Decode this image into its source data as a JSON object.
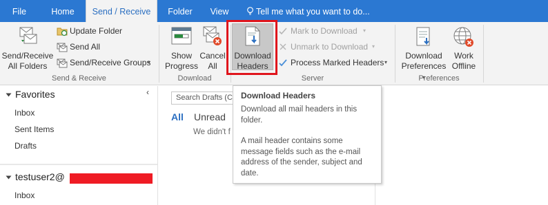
{
  "tabs": [
    {
      "label": "File",
      "active": false
    },
    {
      "label": "Home",
      "active": false
    },
    {
      "label": "Send / Receive",
      "active": true
    },
    {
      "label": "Folder",
      "active": false
    },
    {
      "label": "View",
      "active": false
    }
  ],
  "tell_me": "Tell me what you want to do...",
  "ribbon": {
    "send_receive_group": {
      "label": "Send & Receive",
      "send_receive_all": [
        "Send/Receive",
        "All Folders"
      ],
      "update_folder": "Update Folder",
      "send_all": "Send All",
      "send_receive_groups": "Send/Receive Groups"
    },
    "download_group": {
      "label": "Download",
      "show_progress": [
        "Show",
        "Progress"
      ],
      "cancel_all": [
        "Cancel",
        "All"
      ]
    },
    "server_group": {
      "label": "Server",
      "download_headers": [
        "Download",
        "Headers"
      ],
      "mark_to_download": "Mark to Download",
      "unmark_to_download": "Unmark to Download",
      "process_marked_headers": "Process Marked Headers"
    },
    "preferences_group": {
      "label": "Preferences",
      "download_preferences": [
        "Download",
        "Preferences"
      ],
      "work_offline": [
        "Work",
        "Offline"
      ]
    }
  },
  "nav": {
    "favorites_header": "Favorites",
    "favorites": [
      "Inbox",
      "Sent Items",
      "Drafts"
    ],
    "account": "testuser2@",
    "account_items": [
      "Inbox"
    ]
  },
  "message_list": {
    "search_placeholder": "Search Drafts (Ct",
    "filter_all": "All",
    "filter_unread": "Unread",
    "empty_text": "We didn't f"
  },
  "tooltip": {
    "title": "Download Headers",
    "line1": "Download all mail headers in this folder.",
    "line2": "A mail header contains some message fields such as the e-mail address of the sender, subject and date."
  },
  "colors": {
    "accent": "#2b78d2",
    "highlight_box": "#e0151c",
    "redaction": "#ef1b24"
  }
}
